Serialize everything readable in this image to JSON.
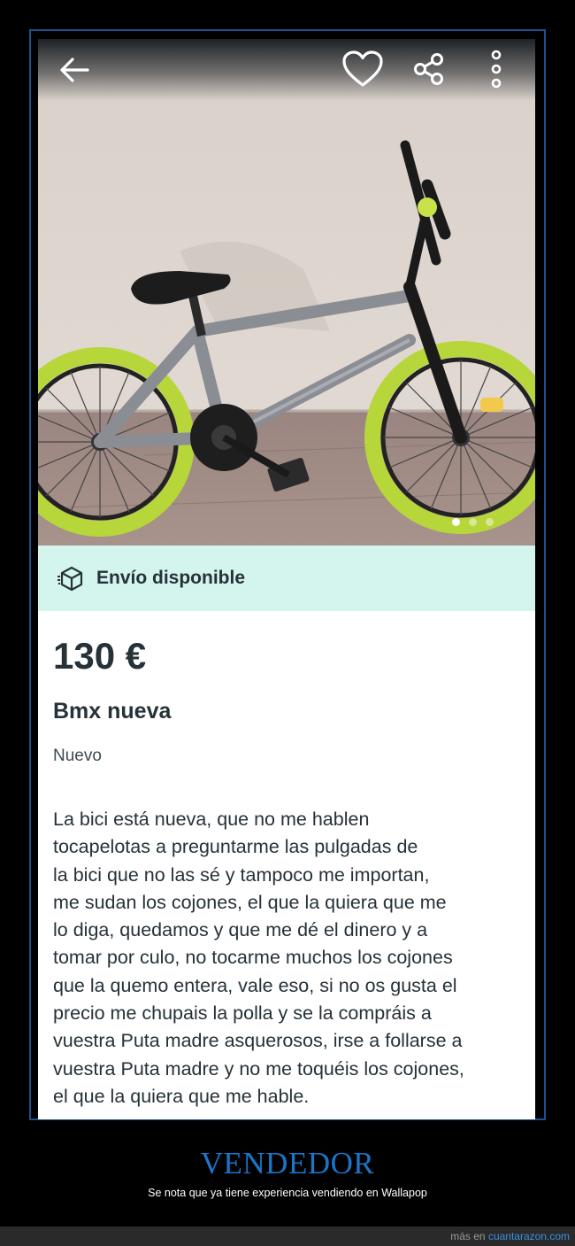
{
  "listing": {
    "shipping_label": "Envío disponible",
    "price": "130 €",
    "title": "Bmx nueva",
    "condition": "Nuevo",
    "description_lines": [
      "La bici está nueva, que no me hablen",
      "tocapelotas a preguntarme las pulgadas de",
      "la bici que no las sé y tampoco me importan,",
      "me sudan los cojones, el que la quiera que me",
      "lo diga, quedamos y que me dé el dinero y a",
      "tomar por culo, no tocarme muchos los cojones",
      "que la quemo entera, vale eso, si no os gusta el",
      "precio me chupais la polla y se la compráis a",
      "vuestra Puta madre asquerosos, irse a follarse a",
      "vuestra Puta madre y no me toquéis los cojones,",
      "el que la quiera que me hable."
    ],
    "gallery": {
      "image_count": 3,
      "active_index": 0
    }
  },
  "toolbar": {
    "back_icon": "arrow-left-icon",
    "favorite_icon": "heart-icon",
    "share_icon": "share-icon",
    "more_icon": "more-vertical-icon"
  },
  "caption": {
    "title": "VENDEDOR",
    "subtitle": "Se nota que ya tiene experiencia vendiendo en Wallapop"
  },
  "footer": {
    "prefix": "más en ",
    "site": "cuantarazon.com"
  },
  "colors": {
    "shipping_bg": "#d4f5ee",
    "text_dark": "#253238",
    "caption_blue": "#1a76c9",
    "frame_border": "#1d4f91"
  }
}
